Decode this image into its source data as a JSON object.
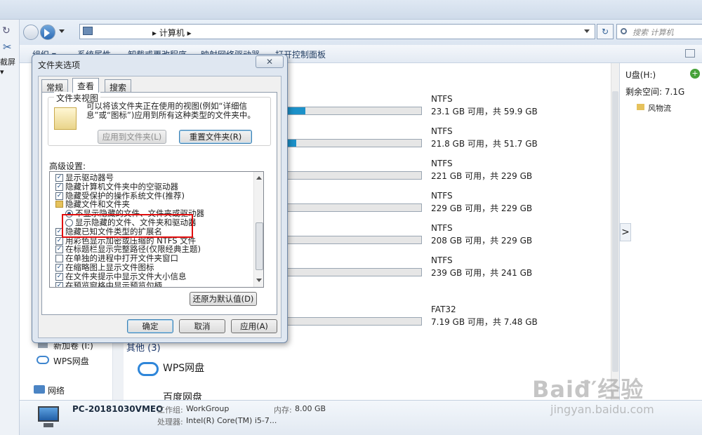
{
  "top_strip": {
    "left_labels": [
      "↻",
      "✂",
      "截屏▾"
    ]
  },
  "address": {
    "breadcrumb": "▸ 计算机 ▸",
    "search_placeholder": "搜索 计算机",
    "refresh_icon": "↻"
  },
  "toolbar": {
    "items": [
      "组织 ▾",
      "系统属性",
      "卸载或更改程序",
      "映射网络驱动器",
      "打开控制面板"
    ]
  },
  "drives": [
    {
      "fs": "NTFS",
      "space": "23.1 GB 可用，共 59.9 GB",
      "used_fraction": 0.61
    },
    {
      "fs": "NTFS",
      "space": "21.8 GB 可用，共 51.7 GB",
      "used_fraction": 0.58
    },
    {
      "fs": "NTFS",
      "space": "221 GB 可用，共 229 GB",
      "used_fraction": 0.03
    },
    {
      "fs": "NTFS",
      "space": "229 GB 可用，共 229 GB",
      "used_fraction": 0.0
    },
    {
      "fs": "NTFS",
      "space": "208 GB 可用，共 229 GB",
      "used_fraction": 0.09
    },
    {
      "fs": "NTFS",
      "space": "239 GB 可用，共 241 GB",
      "used_fraction": 0.01
    },
    {
      "fs": "FAT32",
      "space": "7.19 GB 可用，共 7.48 GB",
      "used_fraction": 0.04
    }
  ],
  "content_extra": {
    "other_header": "其他 (3)",
    "wps": "WPS网盘",
    "baidu": "百度网盘"
  },
  "nav": {
    "items": [
      "新加卷 (I:)",
      "WPS网盘",
      "网络"
    ]
  },
  "right_pane": {
    "title": "U盘(H:)",
    "free": "剩余空间: 7.1G",
    "folder": "风物流",
    "arrow": ">",
    "plus": "+"
  },
  "status": {
    "pc_name": "PC-20181030VMEO",
    "workgroup_label": "工作组:",
    "workgroup": "WorkGroup",
    "memory_label": "内存:",
    "memory": "8.00 GB",
    "cpu_label": "处理器:",
    "cpu": "Intel(R) Core(TM) i5-7..."
  },
  "dialog": {
    "title": "文件夹选项",
    "close": "✕",
    "tabs": [
      "常规",
      "查看",
      "搜索"
    ],
    "folder_view_legend": "文件夹视图",
    "folder_view_desc": "可以将该文件夹正在使用的视图(例如“详细信息”或“图标”)应用到所有这种类型的文件夹中。",
    "apply_to_folders": "应用到文件夹(L)",
    "reset_folders": "重置文件夹(R)",
    "advanced_label": "高级设置:",
    "settings": [
      {
        "kind": "check",
        "checked": true,
        "label": "显示驱动器号"
      },
      {
        "kind": "check",
        "checked": true,
        "label": "隐藏计算机文件夹中的空驱动器"
      },
      {
        "kind": "check",
        "checked": true,
        "label": "隐藏受保护的操作系统文件(推荐)"
      },
      {
        "kind": "folder",
        "label": "隐藏文件和文件夹"
      },
      {
        "kind": "radio",
        "checked": true,
        "label": "不显示隐藏的文件、文件夹或驱动器"
      },
      {
        "kind": "radio",
        "checked": false,
        "label": "显示隐藏的文件、文件夹和驱动器"
      },
      {
        "kind": "check",
        "checked": true,
        "label": "隐藏已知文件类型的扩展名"
      },
      {
        "kind": "check",
        "checked": true,
        "label": "用彩色显示加密或压缩的 NTFS 文件"
      },
      {
        "kind": "check",
        "checked": true,
        "label": "在标题栏显示完整路径(仅限经典主题)"
      },
      {
        "kind": "check",
        "checked": false,
        "label": "在单独的进程中打开文件夹窗口"
      },
      {
        "kind": "check",
        "checked": true,
        "label": "在缩略图上显示文件图标"
      },
      {
        "kind": "check",
        "checked": true,
        "label": "在文件夹提示中显示文件大小信息"
      },
      {
        "kind": "check",
        "checked": true,
        "label": "在预览窗格中显示预览句柄"
      }
    ],
    "restore_defaults": "还原为默认值(D)",
    "ok": "确定",
    "cancel": "取消",
    "apply": "应用(A)"
  },
  "watermark": {
    "brand": "Baiđ′经验",
    "url": "jingyan.baidu.com"
  },
  "colors": {
    "highlight_box": "#e10d0d",
    "drive_bar": "#1c91c9"
  }
}
